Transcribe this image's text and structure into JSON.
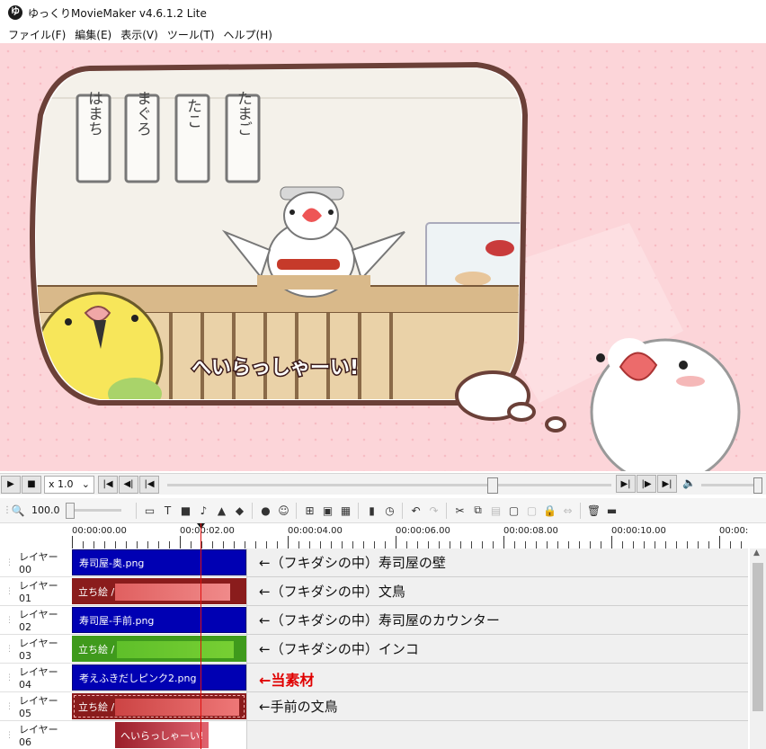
{
  "window": {
    "title": "ゆっくりMovieMaker v4.6.1.2 Lite",
    "icon_glyph": "ゆ"
  },
  "menu": [
    "ファイル(F)",
    "編集(E)",
    "表示(V)",
    "ツール(T)",
    "ヘルプ(H)"
  ],
  "preview": {
    "signs": [
      "はまち",
      "まぐろ",
      "たこ",
      "たまご"
    ],
    "caption": "へいらっしゃーい!",
    "bg_color": "#fcd5d9"
  },
  "transport": {
    "speed": "x 1.0"
  },
  "toolbar": {
    "zoom": "100.0"
  },
  "ruler": [
    "00:00:00.00",
    "00:00:02.00",
    "00:00:04.00",
    "00:00:06.00",
    "00:00:08.00",
    "00:00:10.00",
    "00:00:"
  ],
  "layers": [
    {
      "label": "レイヤー 00",
      "clip": "寿司屋-奥.png",
      "type": "blue",
      "note": "←（フキダシの中）寿司屋の壁"
    },
    {
      "label": "レイヤー 01",
      "clip": "立ち絵 /",
      "type": "red",
      "note": "←（フキダシの中）文鳥"
    },
    {
      "label": "レイヤー 02",
      "clip": "寿司屋-手前.png",
      "type": "blue",
      "note": "←（フキダシの中）寿司屋のカウンター"
    },
    {
      "label": "レイヤー 03",
      "clip": "立ち絵 /",
      "type": "green",
      "note": "←（フキダシの中）インコ"
    },
    {
      "label": "レイヤー 04",
      "clip": "考えふきだしピンク2.png",
      "type": "blue",
      "note": "←当素材",
      "highlight": true
    },
    {
      "label": "レイヤー 05",
      "clip": "立ち絵 /",
      "type": "red",
      "note": "←手前の文鳥"
    },
    {
      "label": "レイヤー 06",
      "clip": "へいらっしゃーい!",
      "type": "text",
      "note": ""
    }
  ],
  "colors": {
    "clip_blue": "#0000b3",
    "clip_red": "#8a1c1c",
    "clip_green": "#66cc33",
    "playhead": "#e01010",
    "note_highlight": "#e00000"
  }
}
